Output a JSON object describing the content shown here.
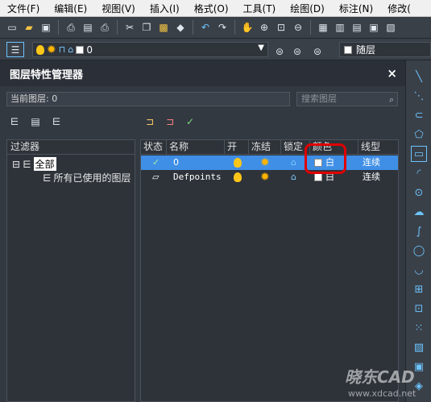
{
  "menu": [
    "文件(F)",
    "编辑(E)",
    "视图(V)",
    "插入(I)",
    "格式(O)",
    "工具(T)",
    "绘图(D)",
    "标注(N)",
    "修改("
  ],
  "layer_combo": {
    "value": "0"
  },
  "color_combo": {
    "value": "随层"
  },
  "panel": {
    "title": "图层特性管理器",
    "close": "×",
    "current_layer": "当前图层: 0",
    "search_placeholder": "搜索图层"
  },
  "filters": {
    "header": "过滤器",
    "tree": [
      {
        "label": "全部",
        "expander": "⊟",
        "selected": true
      },
      {
        "label": "所有已使用的图层"
      }
    ]
  },
  "table": {
    "columns": [
      "状态",
      "名称",
      "开",
      "冻结",
      "锁定",
      "颜色",
      "线型"
    ],
    "rows": [
      {
        "status": "✓",
        "name": "0",
        "color": "白",
        "linetype": "连续",
        "selected": true
      },
      {
        "status": "▱",
        "name": "Defpoints",
        "color": "白",
        "linetype": "连续",
        "selected": false
      }
    ]
  },
  "watermark": {
    "text": "晓东CAD",
    "url": "www.xdcad.net"
  },
  "colors": {
    "selection": "#3f8fe6",
    "annotation": "#e00000",
    "accent": "#6cc4ff"
  }
}
